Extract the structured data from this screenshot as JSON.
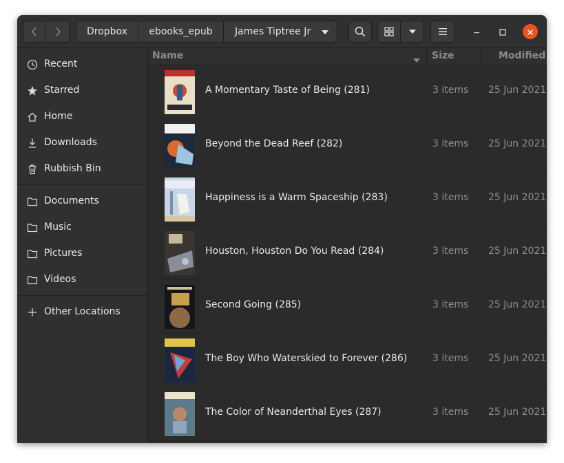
{
  "toolbar": {
    "back_icon": "chevron-left-icon",
    "forward_icon": "chevron-right-icon",
    "breadcrumbs": [
      "Dropbox",
      "ebooks_epub",
      "James Tiptree Jr"
    ],
    "search_icon": "search-icon",
    "view_icon": "grid-view-icon",
    "menu_icon": "hamburger-menu-icon"
  },
  "window_controls": {
    "close_color": "#e95420"
  },
  "sidebar": {
    "items": [
      {
        "label": "Recent",
        "icon": "clock-icon"
      },
      {
        "label": "Starred",
        "icon": "star-icon"
      },
      {
        "label": "Home",
        "icon": "home-icon"
      },
      {
        "label": "Downloads",
        "icon": "download-icon"
      },
      {
        "label": "Rubbish Bin",
        "icon": "trash-icon"
      },
      {
        "label": "Documents",
        "icon": "folder-icon"
      },
      {
        "label": "Music",
        "icon": "folder-icon"
      },
      {
        "label": "Pictures",
        "icon": "folder-icon"
      },
      {
        "label": "Videos",
        "icon": "folder-icon"
      },
      {
        "label": "Other Locations",
        "icon": "plus-icon"
      }
    ]
  },
  "list": {
    "columns": {
      "name": "Name",
      "size": "Size",
      "modified": "Modified"
    },
    "rows": [
      {
        "name": "A Momentary Taste of Being (281)",
        "size": "3 items",
        "modified": "25 Jun 2021"
      },
      {
        "name": "Beyond the Dead Reef (282)",
        "size": "3 items",
        "modified": "25 Jun 2021"
      },
      {
        "name": "Happiness is a Warm Spaceship (283)",
        "size": "3 items",
        "modified": "25 Jun 2021"
      },
      {
        "name": "Houston, Houston Do You Read (284)",
        "size": "3 items",
        "modified": "25 Jun 2021"
      },
      {
        "name": "Second Going (285)",
        "size": "3 items",
        "modified": "25 Jun 2021"
      },
      {
        "name": "The Boy Who Waterskied to Forever (286)",
        "size": "3 items",
        "modified": "25 Jun 2021"
      },
      {
        "name": "The Color of Neanderthal Eyes (287)",
        "size": "3 items",
        "modified": "25 Jun 2021"
      }
    ]
  }
}
